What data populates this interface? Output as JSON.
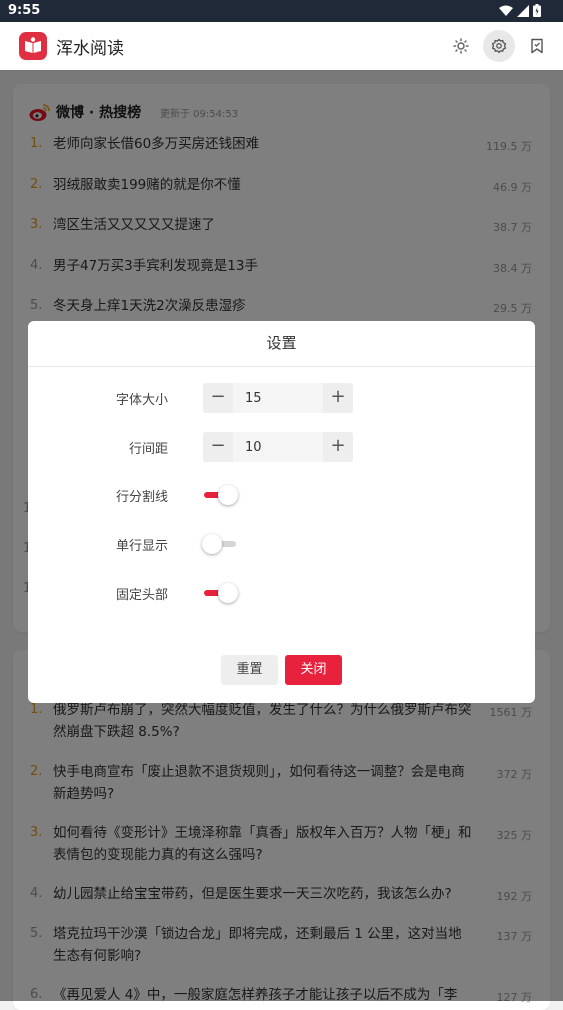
{
  "status_bar": {
    "time": "9:55"
  },
  "app": {
    "title": "浑水阅读"
  },
  "card1": {
    "title": "微博 · 热搜榜",
    "updated": "更新于 09:54:53",
    "items": [
      {
        "rank": "1.",
        "title": "老师向家长借60多万买房还钱困难",
        "hot": "119.5 万"
      },
      {
        "rank": "2.",
        "title": "羽绒服敢卖199赌的就是你不懂",
        "hot": "46.9 万"
      },
      {
        "rank": "3.",
        "title": "湾区生活又又又又又提速了",
        "hot": "38.7 万"
      },
      {
        "rank": "4.",
        "title": "男子47万买3手宾利发现竟是13手",
        "hot": "38.4 万"
      },
      {
        "rank": "5.",
        "title": "冬天身上痒1天洗2次澡反患湿疹",
        "hot": "29.5 万"
      }
    ],
    "hidden_ranks": [
      "1",
      "1",
      "1"
    ]
  },
  "card2": {
    "items": [
      {
        "rank": "1.",
        "title": "俄罗斯卢布崩了，突然大幅度贬值，发生了什么？为什么俄罗斯卢布突然崩盘下跌超 8.5%?",
        "hot": "1561 万"
      },
      {
        "rank": "2.",
        "title": "快手电商宣布「废止退款不退货规则」，如何看待这一调整？会是电商新趋势吗?",
        "hot": "372 万"
      },
      {
        "rank": "3.",
        "title": "如何看待《变形计》王境泽称靠「真香」版权年入百万？人物「梗」和表情包的变现能力真的有这么强吗?",
        "hot": "325 万"
      },
      {
        "rank": "4.",
        "title": "幼儿园禁止给宝宝带药，但是医生要求一天三次吃药，我该怎么办?",
        "hot": "192 万"
      },
      {
        "rank": "5.",
        "title": "塔克拉玛干沙漠「锁边合龙」即将完成，还剩最后 1 公里，这对当地生态有何影响?",
        "hot": "137 万"
      },
      {
        "rank": "6.",
        "title": "《再见爱人 4》中，一般家庭怎样养孩子才能让孩子以后不成为「李",
        "hot": "127 万"
      }
    ]
  },
  "settings": {
    "title": "设置",
    "font_size_label": "字体大小",
    "font_size_value": "15",
    "line_spacing_label": "行间距",
    "line_spacing_value": "10",
    "row_divider_label": "行分割线",
    "single_line_label": "单行显示",
    "fixed_header_label": "固定头部",
    "row_divider_on": true,
    "single_line_on": false,
    "fixed_header_on": true,
    "reset_label": "重置",
    "close_label": "关闭",
    "minus_symbol": "−",
    "plus_symbol": "+"
  },
  "colors": {
    "accent": "#e8213d",
    "logo": "#e02e42",
    "top_rank": "#e59a1a"
  }
}
